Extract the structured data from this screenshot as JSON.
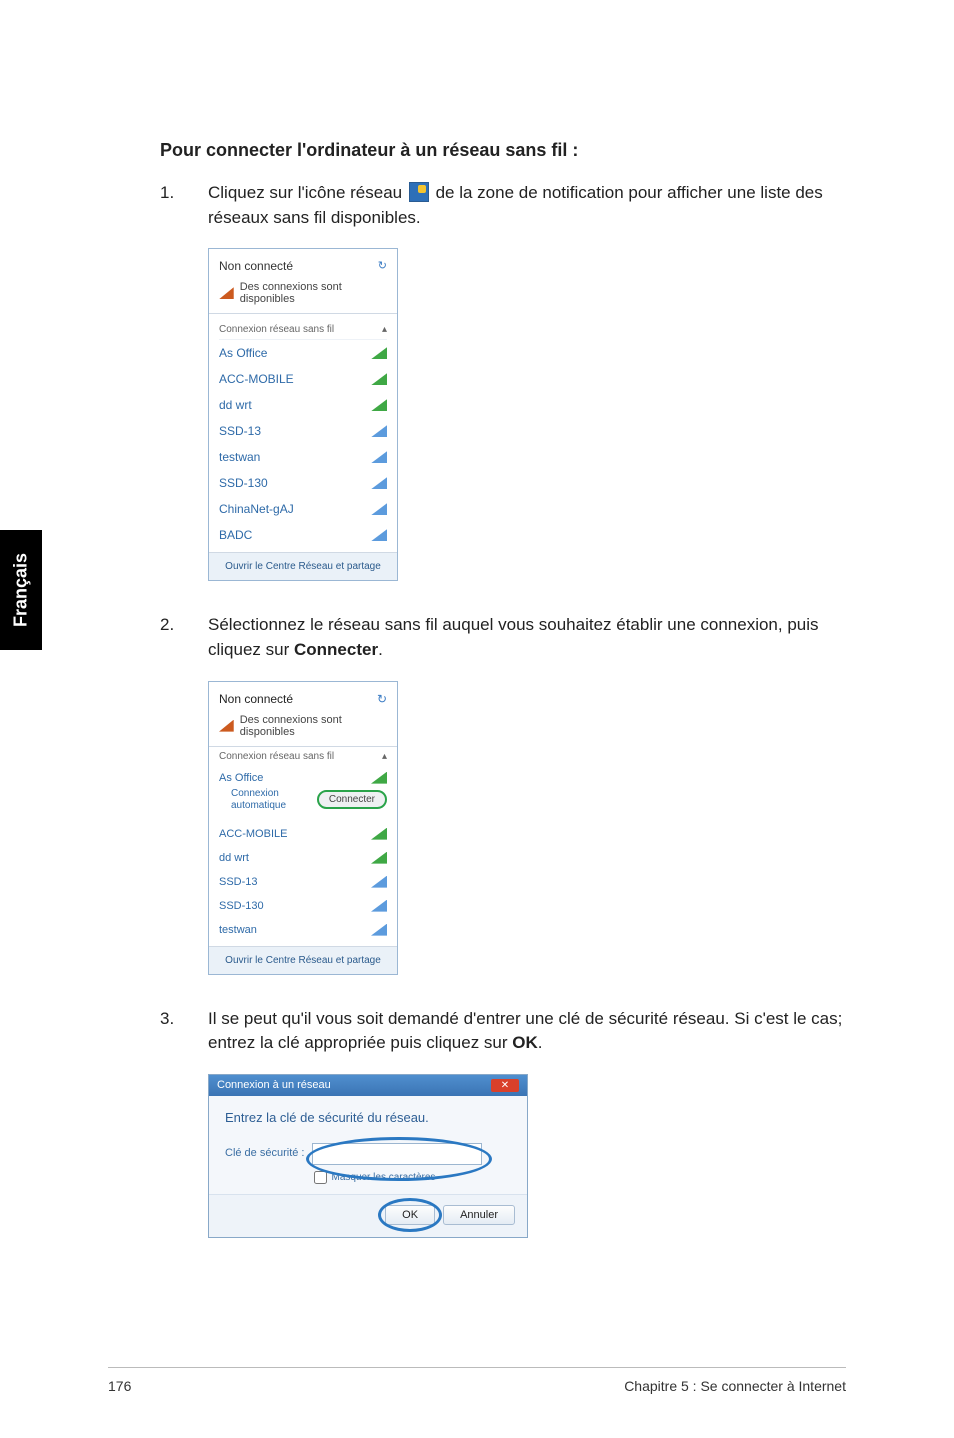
{
  "side_tab": "Français",
  "heading": "Pour connecter l'ordinateur à un réseau sans fil :",
  "steps": {
    "s1": {
      "num": "1.",
      "text_a": "Cliquez sur l'icône réseau ",
      "text_b": " de la zone de notification pour afficher une liste des réseaux sans fil disponibles."
    },
    "s2": {
      "num": "2.",
      "text_a": "Sélectionnez le réseau sans fil auquel vous souhaitez établir une connexion, puis cliquez sur ",
      "bold": "Connecter",
      "text_b": "."
    },
    "s3": {
      "num": "3.",
      "text_a": "Il se peut qu'il vous soit demandé d'entrer une clé de sécurité réseau. Si c'est le cas; entrez la clé appropriée puis cliquez sur ",
      "bold": "OK",
      "text_b": "."
    }
  },
  "shot1": {
    "status": "Non connecté",
    "avail": "Des connexions sont disponibles",
    "sub": "Connexion réseau sans fil",
    "networks": [
      "As Office",
      "ACC-MOBILE",
      "dd wrt",
      "SSD-13",
      "testwan",
      "SSD-130",
      "ChinaNet-gAJ",
      "BADC"
    ],
    "foot": "Ouvrir le Centre Réseau et partage"
  },
  "shot2": {
    "status": "Non connecté",
    "avail": "Des connexions sont disponibles",
    "sub": "Connexion réseau sans fil",
    "selected": "As Office",
    "conn_label1": "Connexion",
    "conn_label2": "automatique",
    "connect_btn": "Connecter",
    "networks": [
      "ACC-MOBILE",
      "dd wrt",
      "SSD-13",
      "SSD-130",
      "testwan"
    ],
    "foot": "Ouvrir le Centre Réseau et partage"
  },
  "shot3": {
    "title": "Connexion à un réseau",
    "msg": "Entrez la clé de sécurité du réseau.",
    "field_label": "Clé de sécurité :",
    "mask": "Masquer les caractères",
    "ok": "OK",
    "cancel": "Annuler"
  },
  "footer": {
    "page": "176",
    "chapter": "Chapitre 5 : Se connecter à Internet"
  }
}
